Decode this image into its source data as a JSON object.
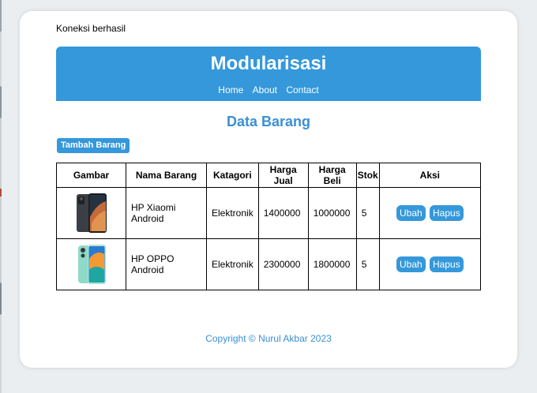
{
  "status": {
    "text": "Koneksi berhasil"
  },
  "header": {
    "title": "Modularisasi",
    "nav": [
      "Home",
      "About",
      "Contact"
    ]
  },
  "main": {
    "title": "Data Barang",
    "add_button": "Tambah Barang"
  },
  "table": {
    "headers": [
      "Gambar",
      "Nama Barang",
      "Katagori",
      "Harga Jual",
      "Harga Beli",
      "Stok",
      "Aksi"
    ],
    "rows": [
      {
        "name": "HP Xiaomi Android",
        "category": "Elektronik",
        "sell_price": "1400000",
        "buy_price": "1000000",
        "stock": "5",
        "edit": "Ubah",
        "delete": "Hapus",
        "image_icon": "phone-xiaomi-icon"
      },
      {
        "name": "HP OPPO Android",
        "category": "Elektronik",
        "sell_price": "2300000",
        "buy_price": "1800000",
        "stock": "5",
        "edit": "Ubah",
        "delete": "Hapus",
        "image_icon": "phone-oppo-icon"
      }
    ]
  },
  "footer": {
    "text": "Copyright © Nurul Akbar 2023"
  },
  "colors": {
    "accent": "#3498db",
    "title_text": "#3a8fd6",
    "background": "#eaeef1"
  }
}
